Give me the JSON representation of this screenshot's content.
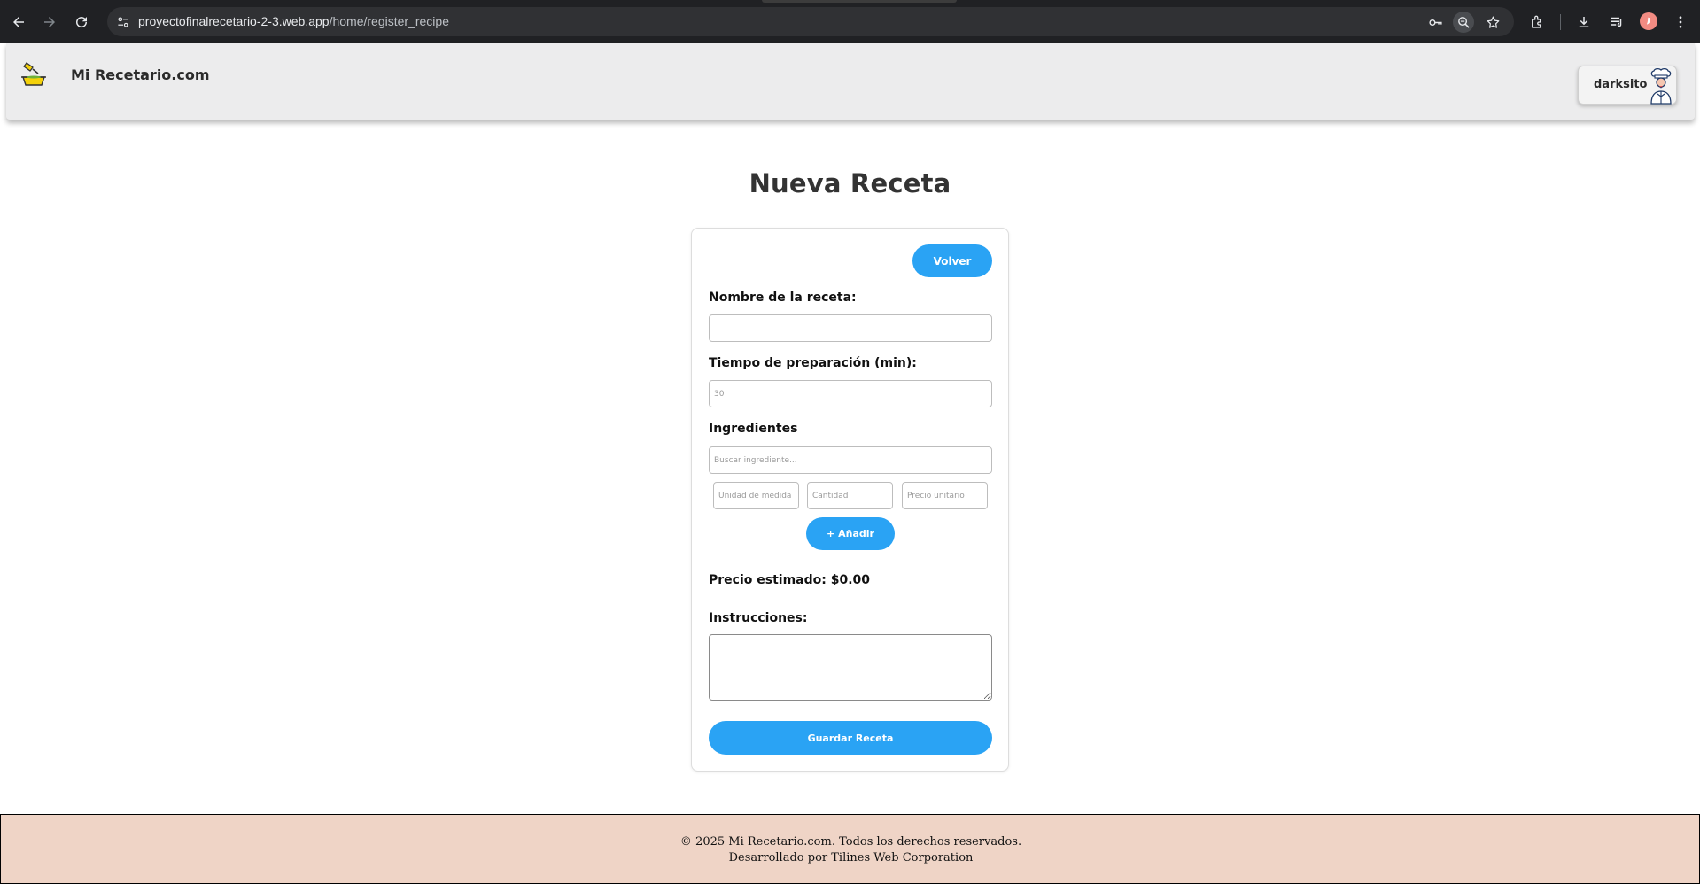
{
  "browser": {
    "url_domain": "proyectofinalrecetario-2-3.web.app",
    "url_path": "/home/register_recipe",
    "icons": [
      "back-icon",
      "forward-icon",
      "reload-icon",
      "site-info-icon",
      "password-key-icon",
      "zoom-icon",
      "bookmark-star-icon",
      "extensions-icon",
      "download-icon",
      "media-control-icon",
      "profile-avatar",
      "menu-dots-icon"
    ]
  },
  "header": {
    "brand": "Mi Recetario.com",
    "username": "darksito"
  },
  "page": {
    "title": "Nueva Receta"
  },
  "form": {
    "back_label": "Volver",
    "name_label": "Nombre de la receta:",
    "name_value": "",
    "time_label": "Tiempo de preparación (min):",
    "time_placeholder": "30",
    "ingredients_label": "Ingredientes",
    "ingredient_search_placeholder": "Buscar ingrediente...",
    "unit_placeholder": "Unidad de medida",
    "quantity_placeholder": "Cantidad",
    "unit_price_placeholder": "Precio unitario",
    "add_label": "+ Añadir",
    "estimated_price": "Precio estimado: $0.00",
    "instructions_label": "Instrucciones:",
    "instructions_value": "",
    "save_label": "Guardar Receta"
  },
  "footer": {
    "line1": "© 2025 Mi Recetario.com. Todos los derechos reservados.",
    "line2": "Desarrollado por Tilines Web Corporation"
  },
  "colors": {
    "accent": "#2aa3f4",
    "header_bg": "#ececed",
    "footer_bg": "#efd4c6",
    "chrome_bg": "#202124"
  }
}
